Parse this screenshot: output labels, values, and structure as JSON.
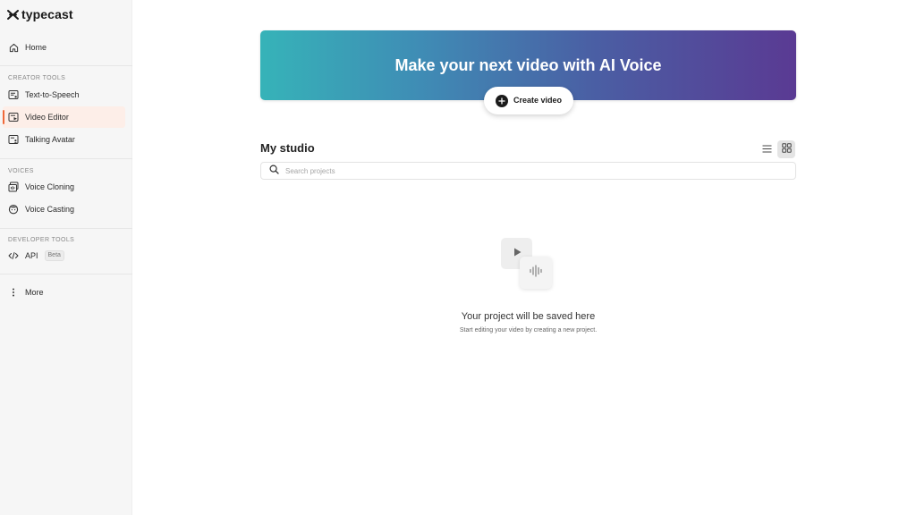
{
  "brand": {
    "name": "typecast"
  },
  "sidebar": {
    "home": {
      "label": "Home",
      "icon": "home-icon"
    },
    "sections": [
      {
        "title": "CREATOR TOOLS"
      },
      {
        "title": "VOICES"
      },
      {
        "title": "DEVELOPER TOOLS"
      }
    ],
    "items": [
      {
        "label": "Text-to-Speech",
        "icon": "text-to-speech-icon"
      },
      {
        "label": "Video Editor",
        "icon": "video-editor-icon",
        "active": true
      },
      {
        "label": "Talking Avatar",
        "icon": "talking-avatar-icon"
      },
      {
        "label": "Voice Cloning",
        "icon": "voice-cloning-icon"
      },
      {
        "label": "Voice Casting",
        "icon": "voice-casting-icon"
      },
      {
        "label": "API",
        "icon": "code-icon",
        "badge": "Beta"
      }
    ],
    "more": {
      "label": "More",
      "icon": "more-vertical-icon"
    }
  },
  "banner": {
    "title": "Make your next video with AI Voice",
    "button_label": "Create video"
  },
  "studio": {
    "title": "My studio",
    "view_mode": "grid",
    "search_placeholder": "Search projects"
  },
  "empty_state": {
    "title": "Your project will be saved here",
    "subtitle": "Start editing your video by creating a new project."
  },
  "colors": {
    "accent": "#f0693a",
    "active_bg": "#fdeee8",
    "banner_gradient": [
      "#36b3b8",
      "#3f8cb5",
      "#4a5fa4",
      "#5a3a93"
    ]
  }
}
